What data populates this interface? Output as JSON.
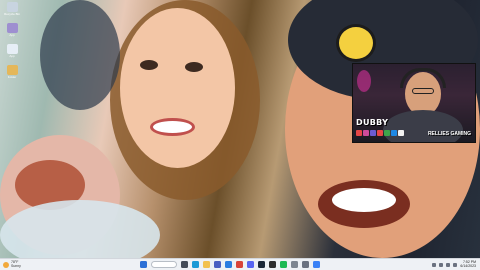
{
  "desktop": {
    "icons": [
      {
        "name": "recycle-bin-icon",
        "label": "Recycle Bin",
        "color": "#c8d4e0"
      },
      {
        "name": "app-icon",
        "label": "App",
        "color": "#9e8fd0"
      },
      {
        "name": "app-icon-2",
        "label": "App",
        "color": "#e6eef6"
      },
      {
        "name": "app-icon-3",
        "label": "Folder",
        "color": "#e4b75a"
      }
    ]
  },
  "webcam": {
    "streamer_name": "DUBBY",
    "team_name": "RELLIES GAMING",
    "social_colors": [
      "#e64646",
      "#cf4b9a",
      "#6b5bd1",
      "#e64646",
      "#3ea34b",
      "#1e88e5",
      "#f2f2f2"
    ]
  },
  "taskbar": {
    "weather_temp": "78°F",
    "weather_desc": "Sunny",
    "center_icons": [
      {
        "name": "start-icon",
        "color": "#2b6fd6"
      },
      {
        "name": "task-view-icon",
        "color": "#444b57"
      },
      {
        "name": "edge-icon",
        "color": "#1b9ad6"
      },
      {
        "name": "file-explorer-icon",
        "color": "#f2c14e"
      },
      {
        "name": "store-icon",
        "color": "#4a5fc1"
      },
      {
        "name": "mail-icon",
        "color": "#2a7de1"
      },
      {
        "name": "chrome-icon",
        "color": "#d8443a"
      },
      {
        "name": "discord-icon",
        "color": "#5865f2"
      },
      {
        "name": "steam-icon",
        "color": "#1b2838"
      },
      {
        "name": "obs-icon",
        "color": "#2e2e2e"
      },
      {
        "name": "spotify-icon",
        "color": "#1db954"
      },
      {
        "name": "app-icon-taskbar",
        "color": "#7d8590"
      },
      {
        "name": "settings-icon",
        "color": "#6b7280"
      },
      {
        "name": "app-icon-taskbar-2",
        "color": "#3b82f6"
      }
    ],
    "clock_time": "7:52 PM",
    "clock_date": "6/14/2023"
  }
}
